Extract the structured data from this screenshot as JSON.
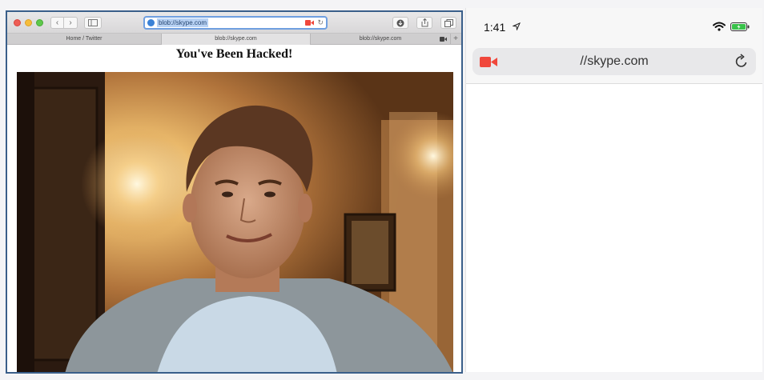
{
  "mac_browser": {
    "url": "blob://skype.com",
    "tabs": [
      {
        "label": "Home / Twitter"
      },
      {
        "label": "blob://skype.com"
      },
      {
        "label": "blob://skype.com"
      }
    ],
    "nav_back": "‹",
    "nav_forward": "›",
    "reload": "↻",
    "download_icon": "download-icon",
    "share_icon": "share-icon",
    "tabs_icon": "tabs-overview-icon",
    "new_tab": "+",
    "page_heading": "You've Been Hacked!",
    "accent_color": "#3a5f8a"
  },
  "ios_safari": {
    "time": "1:41",
    "url": "//skype.com",
    "camera_color": "#f0473b",
    "battery_color": "#39c24a"
  }
}
